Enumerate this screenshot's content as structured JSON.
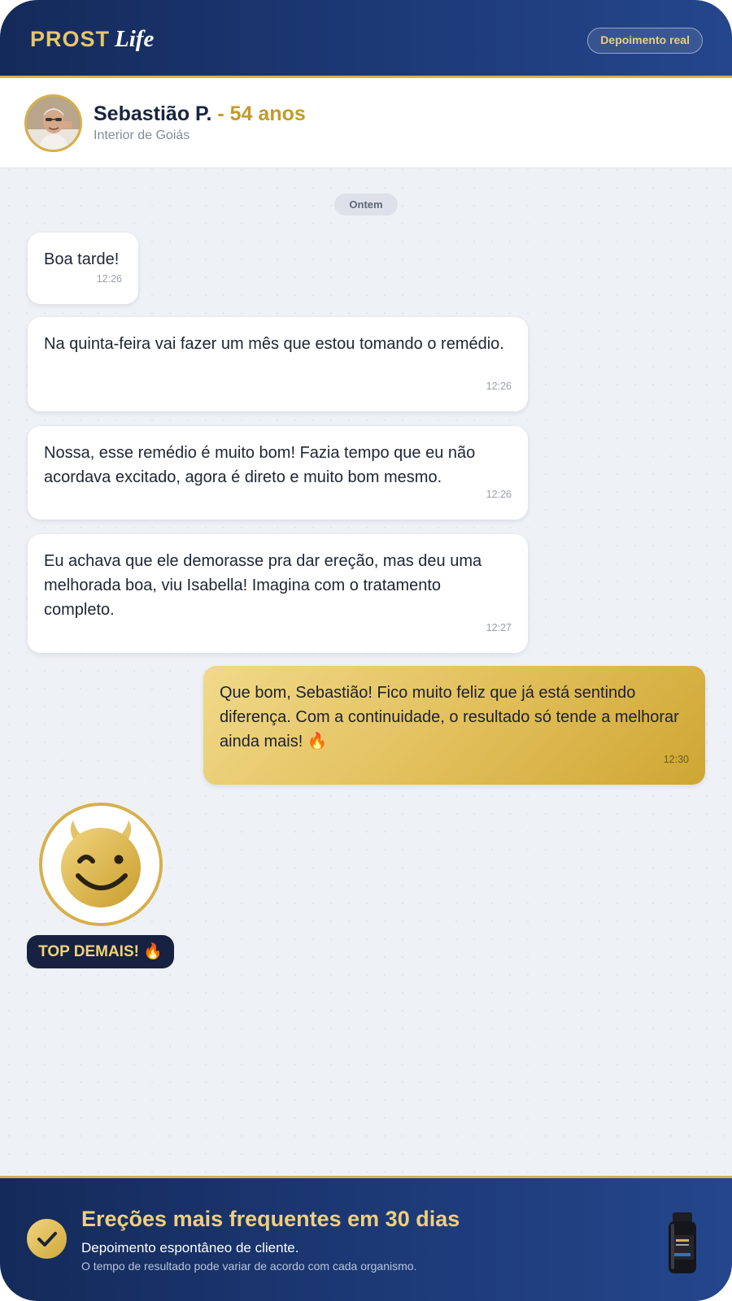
{
  "brand": {
    "prost": "PROST",
    "life": "Life"
  },
  "header": {
    "badge_label": "Depoimento real"
  },
  "profile": {
    "name": "Sebastião P.",
    "age": " - 54 anos",
    "location": "Interior de Goiás"
  },
  "chat": {
    "day_label": "Ontem",
    "messages": [
      {
        "direction": "in",
        "text": "Boa tarde!",
        "time": "12:26"
      },
      {
        "direction": "in",
        "text": "Na quinta-feira vai fazer um mês que estou tomando o remédio.",
        "time": "12:26"
      },
      {
        "direction": "in",
        "text": "Nossa, esse remédio é muito bom! Fazia tempo que eu não acordava excitado, agora é direto e muito bom mesmo.",
        "time": "12:26"
      },
      {
        "direction": "in",
        "text": "Eu achava que ele demorasse pra dar ereção, mas deu uma melhorada boa, viu Isabella! Imagina com o tratamento completo.",
        "time": "12:27"
      },
      {
        "direction": "out",
        "text": "Que bom, Sebastião! Fico muito feliz que já está sentindo diferença. Com a continuidade, o resultado só tende a melhorar ainda mais! 🔥",
        "time": "12:30"
      }
    ],
    "sticker_caption": "TOP DEMAIS! 🔥"
  },
  "footer": {
    "title": "Ereções mais frequentes em 30 dias",
    "subtitle": "Depoimento espontâneo de cliente.",
    "note": "O tempo de resultado pode variar de acordo com cada organismo."
  },
  "icons": {
    "verified": "check-icon",
    "sticker": "smiling-devil-icon",
    "fire": "fire-emoji",
    "product": "supplement-bottle-icon"
  },
  "colors": {
    "navy": "#142a5a",
    "gold": "#d6b04a",
    "accent_text": "#c39a2a",
    "chat_bg": "#eef1f6"
  }
}
